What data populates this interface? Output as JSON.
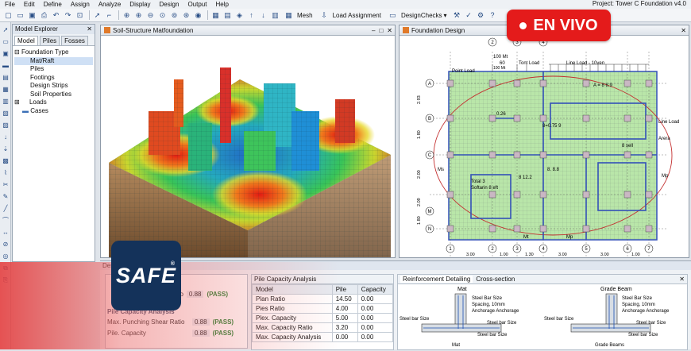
{
  "menu": {
    "items": [
      "File",
      "Edit",
      "Define",
      "Assign",
      "Analyze",
      "Display",
      "Design",
      "Output",
      "Help"
    ],
    "project_title": "Project: Tower C Foundation v4.0"
  },
  "toolbar": {
    "mesh": "Mesh",
    "load_assignment": "Load Assignment",
    "design_checks": "DesignChecks"
  },
  "explorer": {
    "title": "Model Explorer",
    "tabs": [
      "Model",
      "Piles",
      "Fosses"
    ],
    "tree": [
      "Foundation Type",
      "Mat/Raft",
      "Piles",
      "Footings",
      "Design Strips",
      "Soil Properties",
      "Loads",
      "Cases"
    ]
  },
  "view3d": {
    "title": "Soil-Structure Matfoundation"
  },
  "plan": {
    "title": "Foundation Design",
    "grid_x": [
      "1",
      "2",
      "3",
      "4",
      "5",
      "6",
      "7"
    ],
    "grid_y": [
      "A",
      "B",
      "C",
      "M",
      "N"
    ],
    "dims_x": [
      "3.00",
      "1.00",
      "1.30",
      "3.00",
      "3.00",
      "1.00"
    ],
    "dims_y": [
      "2.93",
      "1.80",
      "2.00",
      "2.09",
      "1.80"
    ],
    "labels": {
      "point_load": "Point Load",
      "tont_load": "Tont Load",
      "line_load_top": "Line Load - 10ven",
      "line_load_right": "Line Load",
      "area": "Arera",
      "m100a": "100 Mt",
      "m60": "60",
      "m100b": "100 Mt",
      "ms": "Ms",
      "mp": "Mp",
      "mt": "Mt",
      "total": "Total 3",
      "softarin": "Softarin 8 eft",
      "v1": "A = 8 8.9",
      "v2": "0.26",
      "v3": "8=0.75 9",
      "v4": "8 sell",
      "v5": "8 12.2",
      "v6": "8. 8.8"
    }
  },
  "bottom": {
    "title": "Design",
    "pile_capacity": {
      "title": "Pile Capacity Analysis",
      "cols": [
        "Model",
        "Pile",
        "Capacity"
      ],
      "rows": [
        [
          "Plan Ratio",
          "14.50",
          "0.00"
        ],
        [
          "Pies Ratio",
          "4.00",
          "0.00"
        ],
        [
          "Plex. Capacity",
          "5.00",
          "0.00"
        ],
        [
          "Max. Capacity Ratio",
          "3.20",
          "0.00"
        ],
        [
          "Max. Capacity Analysis",
          "0.00",
          "0.00"
        ]
      ]
    },
    "left": {
      "ratio_label": "atio",
      "ratio_value": "0.88",
      "pass": "(PASS)",
      "section": "Pile Capacity Analysis",
      "rows": [
        [
          "Max. Punching Shear Ratio",
          "0.88",
          "(PASS)"
        ],
        [
          "Pile. Capacity",
          "0.88",
          "(PASS)"
        ]
      ]
    },
    "reinf": {
      "tabs": [
        "Reinforcement Detailing",
        "Cross-section"
      ],
      "mat_title": "Mat",
      "grade_title": "Grade Beam",
      "mat_labels": [
        "Steel Bar Size",
        "Spacing, 10mm",
        "Anchorage Anchorage",
        "Steel bar Size",
        "Steel bar Size",
        "Steel bar Size"
      ],
      "grade_labels": [
        "Steel Bar Size",
        "Spacing, 10mm",
        "Anchorage Anchorage",
        "Steel bar Size",
        "Steel bar Size",
        "Steel bar Size"
      ],
      "mat_bottom": "Mat",
      "grade_bottom": "Grade Beams"
    }
  },
  "overlay": {
    "live": "EN VIVO",
    "brand": "SAFE",
    "reg": "®"
  }
}
